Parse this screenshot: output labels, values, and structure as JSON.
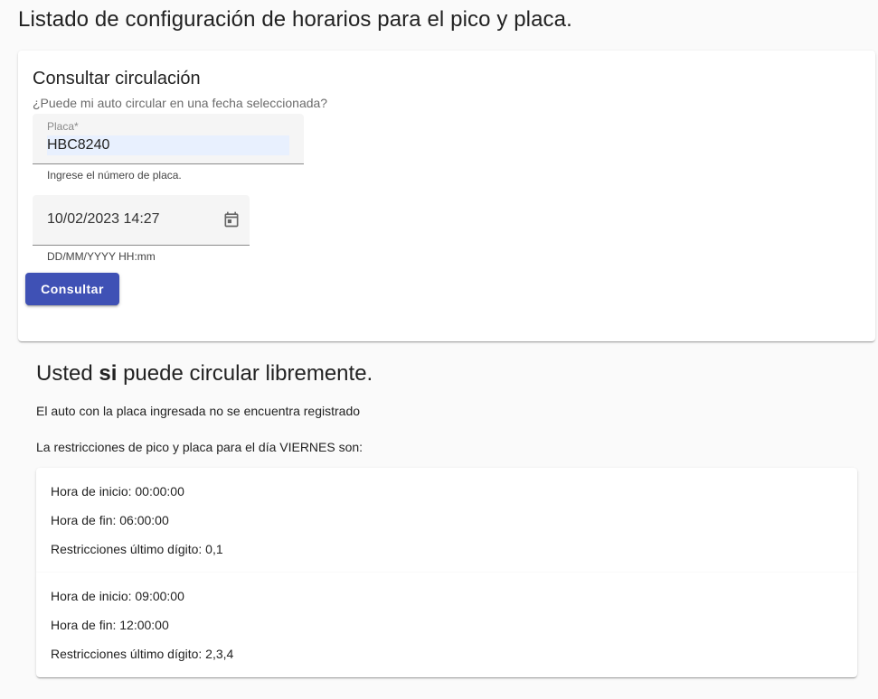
{
  "page": {
    "title": "Listado de configuración de horarios para el pico y placa."
  },
  "consult_card": {
    "title": "Consultar circulación",
    "subtitle": "¿Puede mi auto circular en una fecha seleccionada?",
    "plate_field": {
      "label": "Placa*",
      "value": "HBC8240",
      "hint": "Ingrese el número de placa."
    },
    "date_field": {
      "value": "10/02/2023 14:27",
      "hint": "DD/MM/YYYY HH:mm",
      "icon": "calendar-icon"
    },
    "submit_label": "Consultar"
  },
  "result": {
    "title_prefix": "Usted",
    "title_emphasis": "si",
    "title_suffix": "puede circular libremente.",
    "not_registered_message": "El auto con la placa ingresada no se encuentra registrado",
    "restrictions_message": "La restricciones de pico y placa para el día VIERNES son:",
    "schedules": [
      {
        "start": "Hora de inicio: 00:00:00",
        "end": "Hora de fin: 06:00:00",
        "digits": "Restricciones último dígito: 0,1"
      },
      {
        "start": "Hora de inicio: 09:00:00",
        "end": "Hora de fin: 12:00:00",
        "digits": "Restricciones último dígito: 2,3,4"
      }
    ]
  },
  "colors": {
    "primary": "#3f51b5",
    "autofill": "#e8f0fe",
    "background": "#fafafa"
  }
}
